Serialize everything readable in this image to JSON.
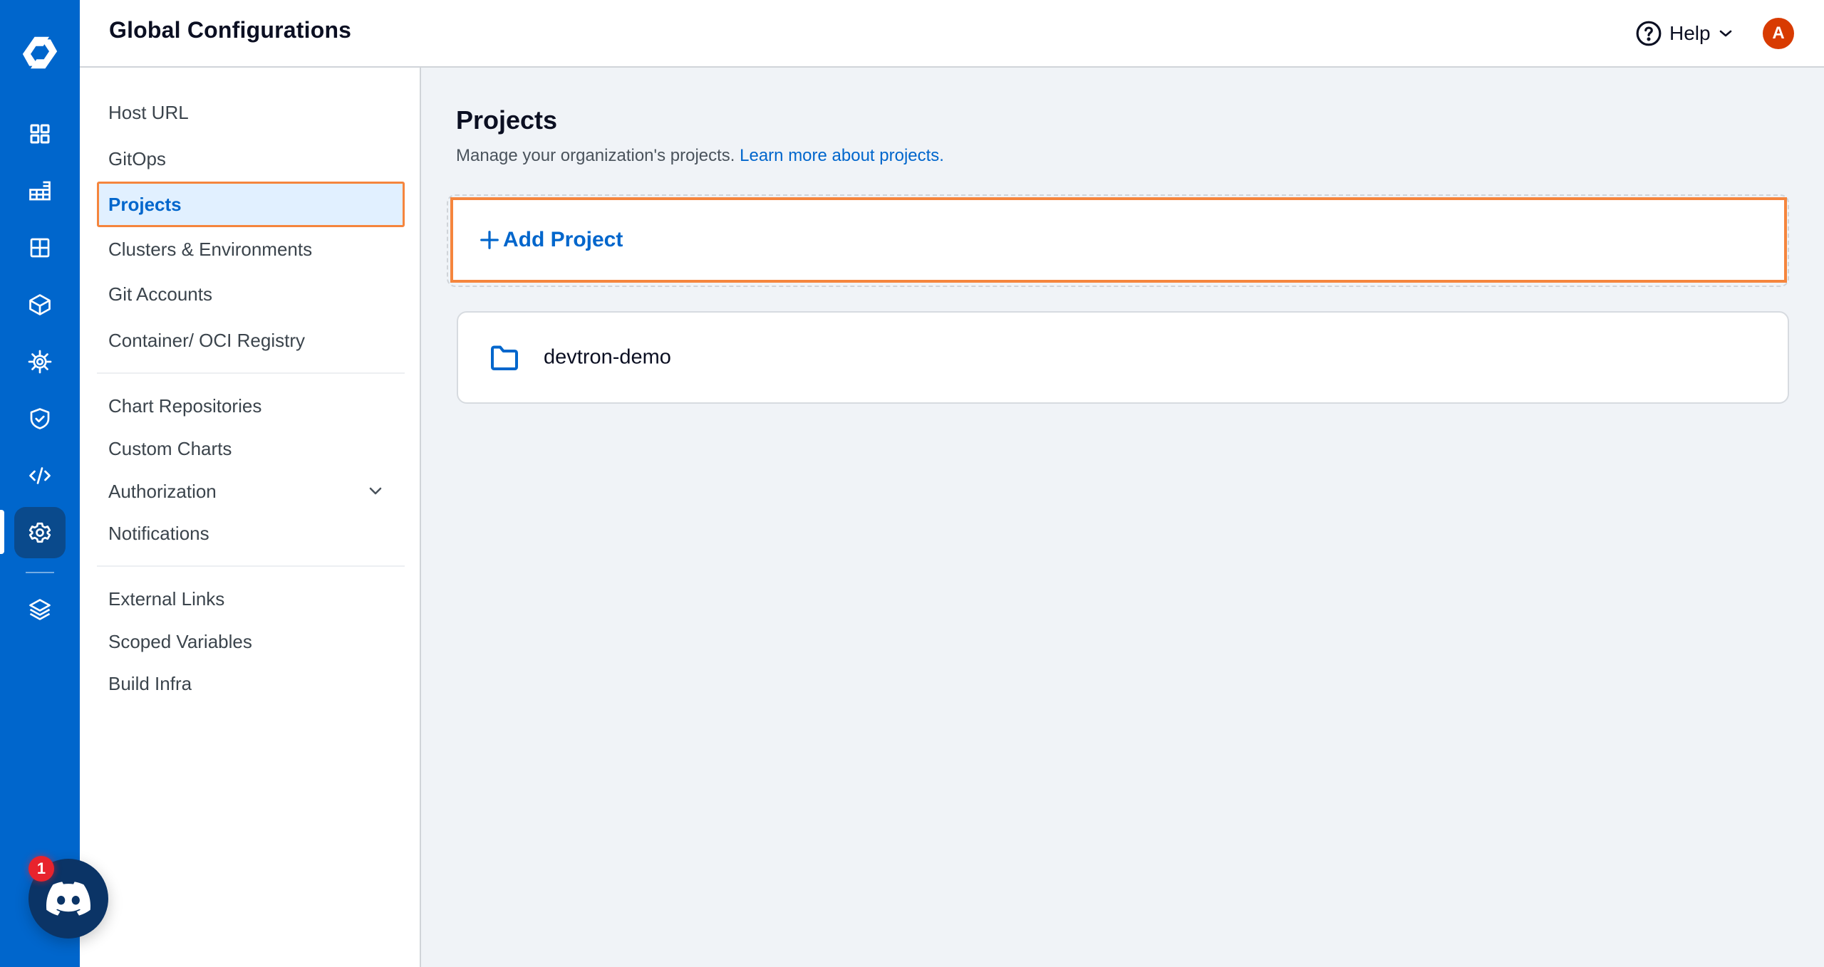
{
  "header": {
    "title": "Global Configurations",
    "help_label": "Help",
    "help_icon": "help-circle-icon",
    "avatar_initial": "A",
    "avatar_color": "#D83B01"
  },
  "rail": {
    "logo": "devtron-logo",
    "items": [
      {
        "name": "applications",
        "icon": "grid-icon"
      },
      {
        "name": "app-groups",
        "icon": "stacked-grid-icon"
      },
      {
        "name": "chart-store",
        "icon": "table-grid-icon"
      },
      {
        "name": "resource-browser",
        "icon": "cube-icon"
      },
      {
        "name": "bulk-edit",
        "icon": "helm-wheel-icon"
      },
      {
        "name": "security",
        "icon": "shield-check-icon"
      },
      {
        "name": "code-editor",
        "icon": "code-icon"
      },
      {
        "name": "global-configurations",
        "icon": "gear-icon",
        "active": true
      },
      {
        "name": "stack-manager",
        "icon": "layers-icon"
      }
    ],
    "brand_color": "#0066CC"
  },
  "config_nav": {
    "groups": [
      [
        {
          "label": "Host URL"
        },
        {
          "label": "GitOps"
        },
        {
          "label": "Projects",
          "selected": true
        },
        {
          "label": "Clusters & Environments"
        },
        {
          "label": "Git Accounts"
        },
        {
          "label": "Container/ OCI Registry"
        }
      ],
      [
        {
          "label": "Chart Repositories"
        },
        {
          "label": "Custom Charts"
        },
        {
          "label": "Authorization",
          "expandable": true
        },
        {
          "label": "Notifications"
        }
      ],
      [
        {
          "label": "External Links"
        },
        {
          "label": "Scoped Variables"
        },
        {
          "label": "Build Infra"
        }
      ]
    ]
  },
  "main": {
    "title": "Projects",
    "description": "Manage your organization's projects.",
    "learn_more_link": "Learn more about projects.",
    "add_button_label": "Add Project",
    "projects": [
      {
        "name": "devtron-demo",
        "icon": "folder-icon"
      }
    ],
    "highlight_color": "#F5853D"
  },
  "discord": {
    "badge_count": "1",
    "icon": "discord-icon"
  }
}
